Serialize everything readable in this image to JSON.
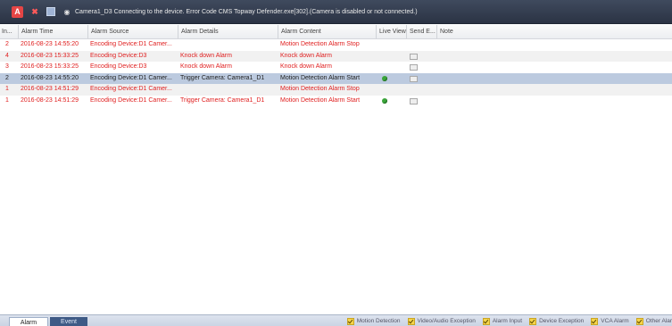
{
  "titlebar": {
    "message": "Camera1_D3 Connecting to the device. Error Code CMS Topway Defender.exe[302].(Camera is disabled or not connected.)"
  },
  "table": {
    "headers": [
      "In...",
      "Alarm Time",
      "Alarm Source",
      "Alarm Details",
      "Alarm Content",
      "Live View",
      "Send E...",
      "Note"
    ],
    "rows": [
      {
        "idx": "2",
        "time": "2016-08-23 14:55:20",
        "source": "Encoding Device:D1 Camer...",
        "details": "",
        "content": "Motion Detection Alarm Stop",
        "live": false,
        "send": false,
        "color": "red",
        "selected": false
      },
      {
        "idx": "4",
        "time": "2016-08-23 15:33:25",
        "source": "Encoding Device:D3",
        "details": "Knock down Alarm",
        "content": "Knock down Alarm",
        "live": false,
        "send": true,
        "color": "red",
        "selected": false
      },
      {
        "idx": "3",
        "time": "2016-08-23 15:33:25",
        "source": "Encoding Device:D3",
        "details": "Knock down Alarm",
        "content": "Knock down Alarm",
        "live": false,
        "send": true,
        "color": "red",
        "selected": false
      },
      {
        "idx": "2",
        "time": "2016-08-23 14:55:20",
        "source": "Encoding Device:D1 Camer...",
        "details": "Trigger Camera: Camera1_D1",
        "content": "Motion Detection Alarm Start",
        "live": true,
        "send": true,
        "color": "dark",
        "selected": true
      },
      {
        "idx": "1",
        "time": "2016-08-23 14:51:29",
        "source": "Encoding Device:D1 Camer...",
        "details": "",
        "content": "Motion Detection Alarm Stop",
        "live": false,
        "send": false,
        "color": "red",
        "selected": false
      },
      {
        "idx": "1",
        "time": "2016-08-23 14:51:29",
        "source": "Encoding Device:D1 Camer...",
        "details": "Trigger Camera: Camera1_D1",
        "content": "Motion Detection Alarm Start",
        "live": true,
        "send": true,
        "color": "red",
        "selected": false
      }
    ]
  },
  "tabs": [
    {
      "label": "Alarm",
      "active": true
    },
    {
      "label": "Event",
      "active": false
    }
  ],
  "filters": [
    "Motion Detection",
    "Video/Audio Exception",
    "Alarm Input",
    "Device Exception",
    "VCA Alarm",
    "Other Alar"
  ]
}
